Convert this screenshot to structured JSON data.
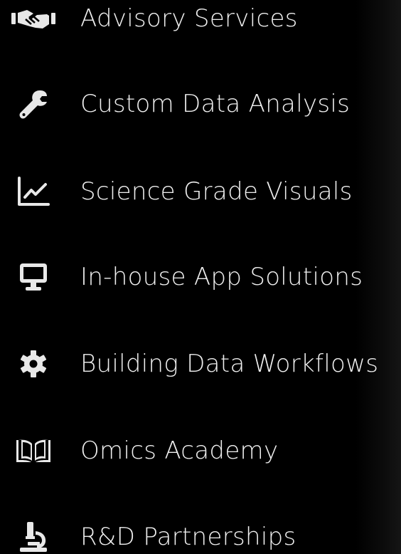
{
  "menu": {
    "items": [
      {
        "label": "Advisory Services",
        "icon": "handshake-icon"
      },
      {
        "label": "Custom Data Analysis",
        "icon": "wrench-icon"
      },
      {
        "label": "Science Grade Visuals",
        "icon": "line-chart-icon"
      },
      {
        "label": "In-house App Solutions",
        "icon": "desktop-icon"
      },
      {
        "label": "Building Data Workflows",
        "icon": "gear-icon"
      },
      {
        "label": "Omics Academy",
        "icon": "book-open-icon"
      },
      {
        "label": "R&D Partnerships",
        "icon": "microscope-icon"
      }
    ]
  },
  "colors": {
    "background": "#000000",
    "text": "#efefef",
    "icon": "#e8e8e8"
  }
}
